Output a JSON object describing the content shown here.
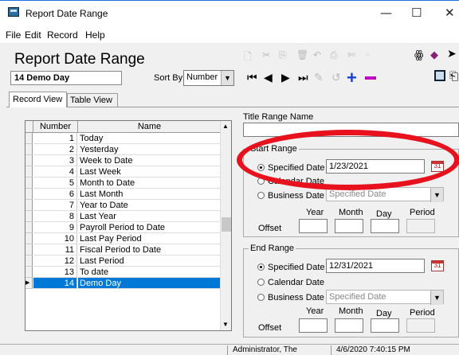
{
  "window": {
    "title": "Report Date Range",
    "minimize": "—",
    "maximize": "☐",
    "close": "✕"
  },
  "menu": [
    "File",
    "Edit",
    "Record",
    "Help"
  ],
  "header": {
    "title": "Report Date Range",
    "current_record": "14 Demo Day",
    "sort_by_label": "Sort By",
    "sort_by_value": "Number"
  },
  "tabs": [
    "Record View",
    "Table View"
  ],
  "table": {
    "columns": [
      "Number",
      "Name"
    ],
    "rows": [
      {
        "num": "1",
        "name": "Today"
      },
      {
        "num": "2",
        "name": "Yesterday"
      },
      {
        "num": "3",
        "name": "Week to Date"
      },
      {
        "num": "4",
        "name": "Last Week"
      },
      {
        "num": "5",
        "name": "Month to Date"
      },
      {
        "num": "6",
        "name": "Last Month"
      },
      {
        "num": "7",
        "name": "Year to Date"
      },
      {
        "num": "8",
        "name": "Last Year"
      },
      {
        "num": "9",
        "name": "Payroll Period to Date"
      },
      {
        "num": "10",
        "name": "Last Pay Period"
      },
      {
        "num": "11",
        "name": "Fiscal Period to Date"
      },
      {
        "num": "12",
        "name": "Last Period"
      },
      {
        "num": "13",
        "name": "To date"
      },
      {
        "num": "14",
        "name": "Demo Day"
      }
    ],
    "selected_index": 13
  },
  "form": {
    "title_range_label": "Title Range Name",
    "title_range_value": "",
    "start": {
      "group_label": "Start Range",
      "specified_label": "Specified Date",
      "specified_value": "1/23/2021",
      "calendar_label": "Calendar Date",
      "business_label": "Business Date",
      "business_value": "Specified Date",
      "year_label": "Year",
      "month_label": "Month",
      "day_label": "Day",
      "period_label": "Period",
      "offset_label": "Offset"
    },
    "end": {
      "group_label": "End Range",
      "specified_label": "Specified Date",
      "specified_value": "12/31/2021",
      "calendar_label": "Calendar Date",
      "business_label": "Business Date",
      "business_value": "Specified Date",
      "year_label": "Year",
      "month_label": "Month",
      "day_label": "Day",
      "period_label": "Period",
      "offset_label": "Offset"
    }
  },
  "status": {
    "user": "Administrator, The",
    "datetime": "4/6/2020 7:40:15 PM"
  },
  "colors": {
    "selection": "#0078d7",
    "annotation": "#e8121e",
    "add_icon": "#1a3fd1",
    "remove_icon": "#c000c0"
  }
}
